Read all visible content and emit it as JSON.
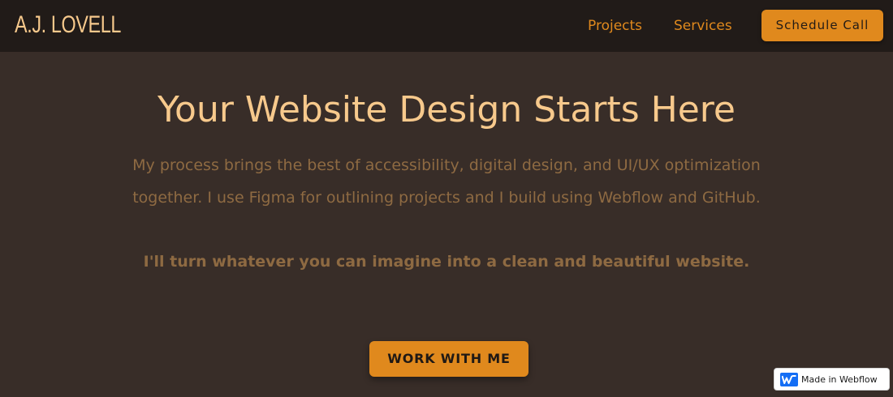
{
  "header": {
    "logo": "A.J. LOVELL",
    "nav": [
      {
        "label": "Projects"
      },
      {
        "label": "Services"
      }
    ],
    "cta_label": "Schedule Call"
  },
  "hero": {
    "title": "Your Website Design Starts Here",
    "body": "My process brings the best of accessibility, digital design, and UI/UX optimization together. I use Figma for outlining projects and I build using Webflow and GitHub.",
    "strong": "I'll turn whatever you can imagine into a clean and beautiful website.",
    "cta_label": "WORK WITH ME"
  },
  "badge": {
    "text": "Made in Webflow",
    "icon": "webflow-logo-icon"
  },
  "colors": {
    "nav_bg": "#211b18",
    "page_bg": "#382d28",
    "accent": "#e0891d",
    "title": "#f7c98c",
    "body_text": "#8e6a42"
  }
}
